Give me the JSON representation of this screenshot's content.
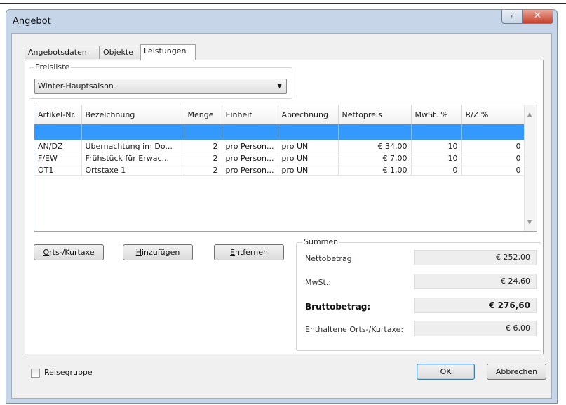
{
  "window": {
    "title": "Angebot",
    "help_glyph": "?",
    "close_glyph": "✕"
  },
  "tabs": [
    {
      "label": "Angebotsdaten",
      "active": false
    },
    {
      "label": "Objekte",
      "active": false
    },
    {
      "label": "Leistungen",
      "active": true
    }
  ],
  "price_list": {
    "label": "Preisliste",
    "selected": "Winter-Hauptsaison"
  },
  "grid": {
    "columns": [
      "Artikel-Nr.",
      "Bezeichnung",
      "Menge",
      "Einheit",
      "Abrechnung",
      "Nettopreis",
      "MwSt. %",
      "R/Z %"
    ],
    "rows": [
      [
        "AN/DZ",
        "Übernachtung im Do...",
        "2",
        "pro Person...",
        "pro ÜN",
        "€ 34,00",
        "10",
        "0"
      ],
      [
        "F/EW",
        "Frühstück für Erwac...",
        "2",
        "pro Person...",
        "pro ÜN",
        "€ 7,00",
        "10",
        "0"
      ],
      [
        "OT1",
        "Ortstaxe 1",
        "2",
        "pro Person...",
        "pro ÜN",
        "€ 1,00",
        "0",
        "0"
      ]
    ]
  },
  "buttons": {
    "ortskurtaxe": {
      "mnemonic": "O",
      "rest": "rts-/Kurtaxe"
    },
    "hinzufuegen": {
      "mnemonic": "H",
      "rest": "inzufügen"
    },
    "entfernen": {
      "mnemonic": "E",
      "rest": "ntfernen"
    },
    "ok": "OK",
    "abbrechen": "Abbrechen"
  },
  "summen": {
    "label": "Summen",
    "netto_label": "Nettobetrag:",
    "netto_value": "€ 252,00",
    "mwst_label": "MwSt.:",
    "mwst_value": "€ 24,60",
    "brutto_label": "Bruttobetrag:",
    "brutto_value": "€ 276,60",
    "orts_label": "Enthaltene Orts-/Kurtaxe:",
    "orts_value": "€ 6,00"
  },
  "reisegruppe": {
    "label": "Reisegruppe",
    "checked": false
  },
  "colors": {
    "selection": "#3399ff",
    "window_frame": "#c6d6e8",
    "close_button": "#c7412c"
  }
}
